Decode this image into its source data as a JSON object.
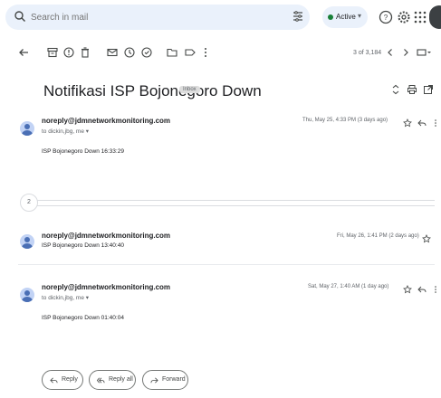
{
  "search": {
    "placeholder": "Search in mail"
  },
  "status": {
    "label": "Active"
  },
  "toolbar": {
    "count": "3 of 3,184"
  },
  "thread": {
    "subject": "Notifikasi ISP Bojonegoro Down",
    "label": "Inbox"
  },
  "messages": [
    {
      "sender": "noreply@jdmnetworkmonitoring.com",
      "to": "to dickin,jbg, me",
      "date": "Thu, May 25, 4:33 PM (3 days ago)",
      "body": "ISP Bojonegoro Down 16:33:29"
    },
    {
      "sender": "noreply@jdmnetworkmonitoring.com",
      "date": "Fri, May 26, 1:41 PM (2 days ago)",
      "body": "ISP Bojonegoro Down 13:40:40"
    },
    {
      "sender": "noreply@jdmnetworkmonitoring.com",
      "to": "to dickin,jbg, me",
      "date": "Sat, May 27, 1:40 AM (1 day ago)",
      "body": "ISP Bojonegoro Down 01:40:04"
    }
  ],
  "collapsed": {
    "count": "2"
  },
  "actions": {
    "reply": "Reply",
    "reply_all": "Reply all",
    "forward": "Forward"
  },
  "colors": {
    "active_dot": "#188038",
    "search_bg": "#eaf1fb"
  }
}
